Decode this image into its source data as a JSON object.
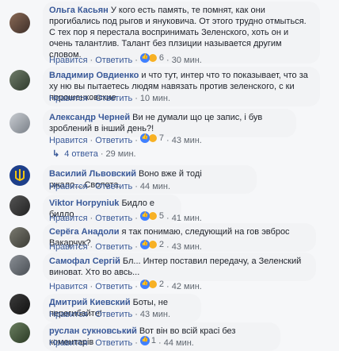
{
  "actions": {
    "like": "Нравится",
    "reply": "Ответить"
  },
  "comments": [
    {
      "author": "Ольга Касьян",
      "text": "У кого есть память, те помнят, как они прогибались под рыгов и януковича. От этого трудно отмыться. С тех пор я перестала воспринимать Зеленского, хоть он и очень талантлив. Талант без плзиции называется другим словом.",
      "count": "6",
      "time": "30 мин."
    },
    {
      "author": "Владимир Овдиенко",
      "text": "и что тут, интер что то показывает, что за ху ню вы пытаетесь людям навязать против зеленского, с ки порошенковские",
      "count": "",
      "time": "10 мин."
    },
    {
      "author": "Александр Черней",
      "text": "Ви не думали що це запис, і був зроблений в інший день?!",
      "count": "7",
      "time": "43 мин."
    },
    {
      "author": "Василий Львовский",
      "text": "Воно вже й тоді ржало....Сволота.",
      "count": "",
      "time": "44 мин."
    },
    {
      "author": "Viktor Horpyniuk",
      "text": "Бидло е бидло",
      "count": "5",
      "time": "41 мин."
    },
    {
      "author": "Серёга Анадоли",
      "text": "я так понимаю, следующий на гов эвброс Вакарчук?",
      "count": "2",
      "time": "43 мин."
    },
    {
      "author": "Самофал Сергій",
      "text": "Бл... Интер поставил передачу, а Зеленский виноват. Хто во авсь...",
      "count": "2",
      "time": "42 мин."
    },
    {
      "author": "Дмитрий Киевский",
      "text": "Боты, не перегибайте!",
      "count": "",
      "time": "43 мин."
    },
    {
      "author": "руслан сукновський",
      "text": "Вот він во всій красі без коментарів",
      "count": "1",
      "time": "44 мин."
    }
  ],
  "replies": {
    "label": "4 ответа",
    "time": "29 мин."
  }
}
